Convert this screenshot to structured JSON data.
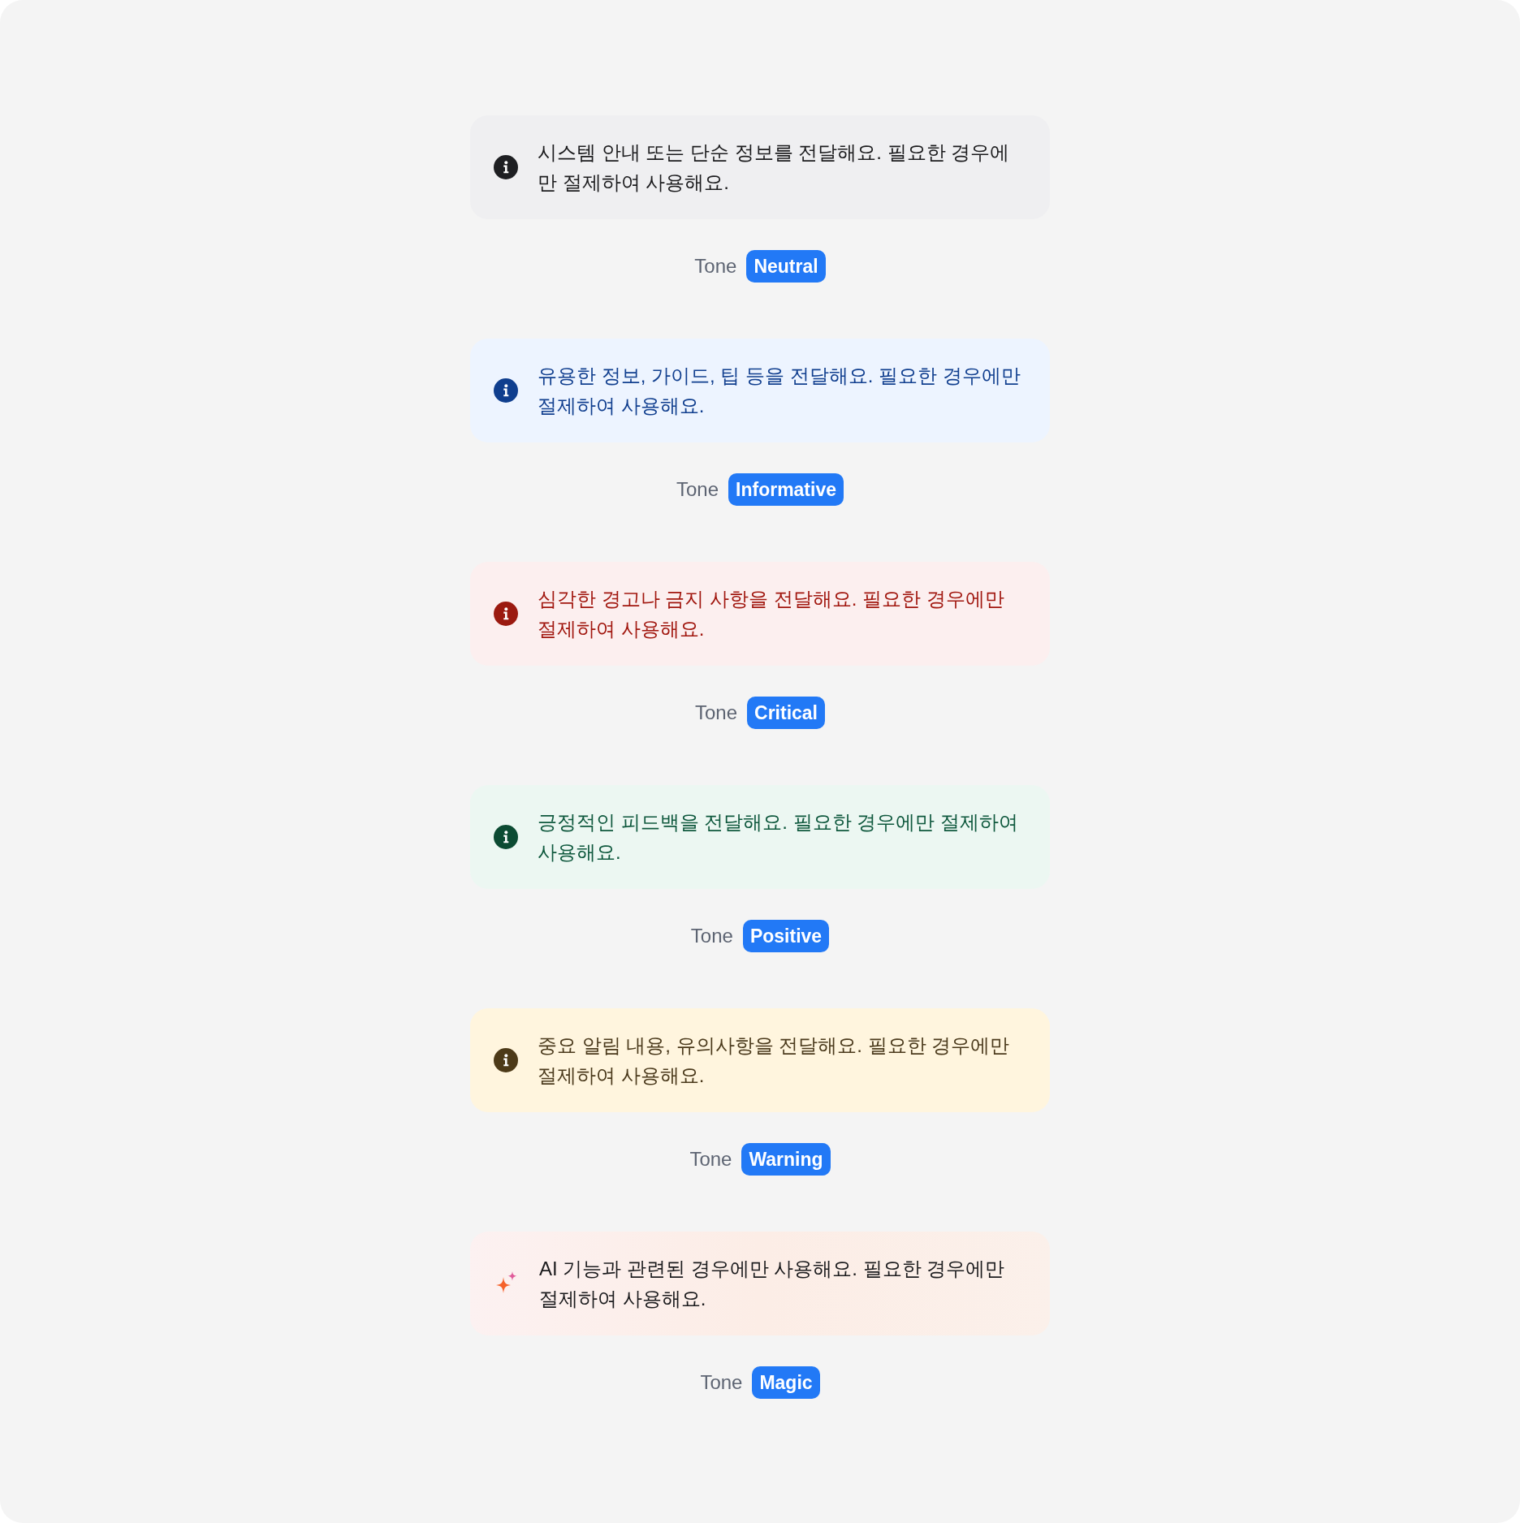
{
  "banners": [
    {
      "kind": "neutral",
      "message": "시스템 안내 또는 단순 정보를 전달해요. 필요한 경우에만 절제하여 사용해요.",
      "label": "Tone",
      "badge": "Neutral"
    },
    {
      "kind": "informative",
      "message": "유용한 정보, 가이드, 팁 등을 전달해요. 필요한 경우에만 절제하여 사용해요.",
      "label": "Tone",
      "badge": "Informative"
    },
    {
      "kind": "critical",
      "message": "심각한 경고나 금지 사항을 전달해요. 필요한 경우에만 절제하여 사용해요.",
      "label": "Tone",
      "badge": "Critical"
    },
    {
      "kind": "positive",
      "message": "긍정적인 피드백을 전달해요. 필요한 경우에만 절제하여 사용해요.",
      "label": "Tone",
      "badge": "Positive"
    },
    {
      "kind": "warning",
      "message": "중요 알림 내용, 유의사항을 전달해요. 필요한 경우에만 절제하여 사용해요.",
      "label": "Tone",
      "badge": "Warning"
    },
    {
      "kind": "magic",
      "message": "AI 기능과 관련된 경우에만 사용해요. 필요한 경우에만 절제하여 사용해요.",
      "label": "Tone",
      "badge": "Magic"
    }
  ]
}
